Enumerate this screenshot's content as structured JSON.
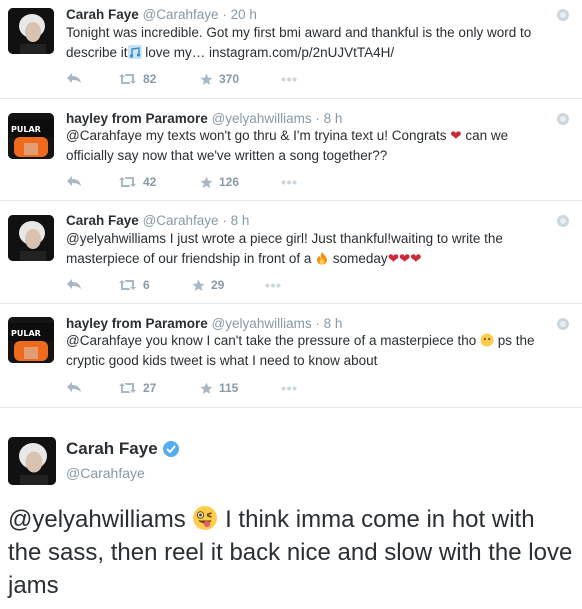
{
  "tweets": [
    {
      "name": "Carah Faye",
      "handle": "@Carahfaye",
      "time": "20 h",
      "text_line1": "Tonight was incredible. Got my first bmi award and thankful is the only word to",
      "text_line2a": "describe it",
      "text_line2b": " love my… instagram.com/p/2nUJVtTA4H/",
      "retweets": "82",
      "favorites": "370"
    },
    {
      "name": "hayley from Paramore",
      "handle": "@yelyahwilliams",
      "time": "8 h",
      "text_line1a": "@Carahfaye my texts won't go thru & I'm tryina text u! Congrats",
      "text_line1b": " can we",
      "text_line2": "officially say now that we've written a song together??",
      "retweets": "42",
      "favorites": "126"
    },
    {
      "name": "Carah Faye",
      "handle": "@Carahfaye",
      "time": "8 h",
      "text_line1": "@yelyahwilliams I just wrote a piece girl! Just thankful!waiting to write the",
      "text_line2a": "masterpiece of our friendship in front of a",
      "text_line2b": " someday",
      "retweets": "6",
      "favorites": "29"
    },
    {
      "name": "hayley from Paramore",
      "handle": "@yelyahwilliams",
      "time": "8 h",
      "text_line1a": "@Carahfaye you know I can't take the pressure of a masterpiece tho",
      "text_line1b": " ps the",
      "text_line2": "cryptic good kids tweet is what I need to know about",
      "retweets": "27",
      "favorites": "115"
    }
  ],
  "featured": {
    "name": "Carah Faye",
    "handle": "@Carahfaye",
    "text_a": "@yelyahwilliams",
    "text_b": " I think imma come in hot with the sass, then reel it back nice and slow with the love jams"
  },
  "icons": [
    "reply-icon",
    "retweet-icon",
    "favorite-icon",
    "more-icon",
    "globe-icon",
    "verified-icon"
  ],
  "colors": {
    "heart": "#cc2a3a",
    "verified": "#55acee",
    "muted": "#8899a6"
  }
}
